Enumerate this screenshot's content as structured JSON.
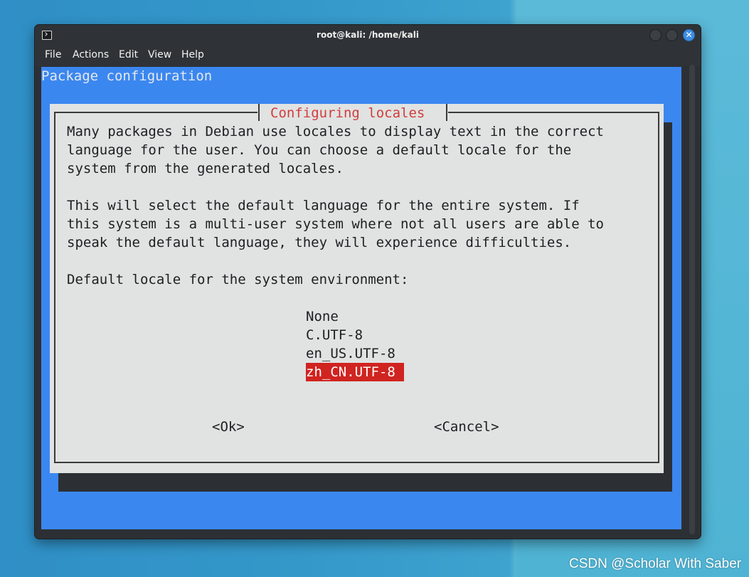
{
  "window": {
    "title": "root@kali: /home/kali",
    "close_glyph": "✕"
  },
  "menu": {
    "file": "File",
    "actions": "Actions",
    "edit": "Edit",
    "view": "View",
    "help": "Help"
  },
  "terminal": {
    "header": "Package configuration",
    "background_color": "#3b87f0"
  },
  "dialog": {
    "title": "Configuring locales",
    "paragraph1": [
      "Many packages in Debian use locales to display text in the correct",
      "language for the user. You can choose a default locale for the",
      "system from the generated locales."
    ],
    "paragraph2": [
      "This will select the default language for the entire system. If",
      "this system is a multi-user system where not all users are able to",
      "speak the default language, they will experience difficulties."
    ],
    "prompt": "Default locale for the system environment:",
    "options": [
      "None",
      "C.UTF-8",
      "en_US.UTF-8",
      "zh_CN.UTF-8"
    ],
    "selected_option": "zh_CN.UTF-8",
    "ok_label": "<Ok>",
    "cancel_label": "<Cancel>",
    "selection_color": "#d02420",
    "title_color": "#d23c3c"
  },
  "watermark": "CSDN @Scholar With Saber"
}
